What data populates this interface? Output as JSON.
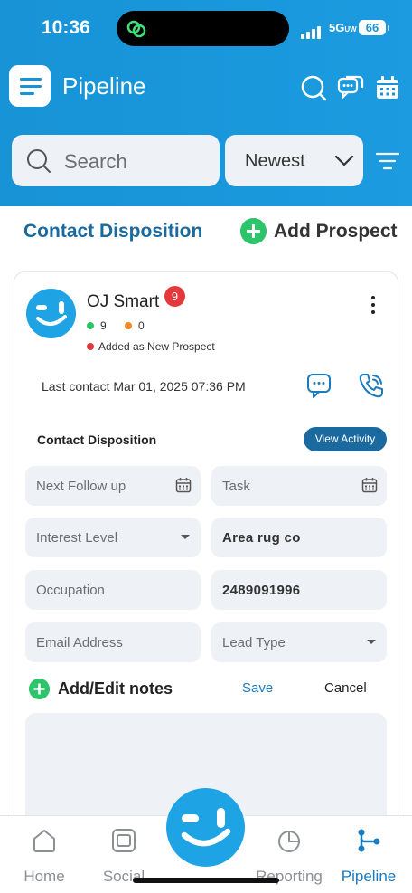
{
  "status_bar": {
    "time": "10:36",
    "network": "5G",
    "network_suffix": "UW",
    "battery": "66"
  },
  "header": {
    "title": "Pipeline",
    "icons": [
      "menu-icon",
      "search-icon",
      "chat-icon",
      "calendar-icon"
    ]
  },
  "search": {
    "placeholder": "Search"
  },
  "sort": {
    "selected": "Newest"
  },
  "links": {
    "contact_disposition": "Contact Disposition",
    "add_prospect": "Add Prospect"
  },
  "prospect": {
    "name": "OJ Smart",
    "badge_count": "9",
    "green_count": "9",
    "orange_count": "0",
    "status": "Added as New Prospect",
    "last_contact": "Last contact Mar 01, 2025 07:36 PM"
  },
  "disposition": {
    "title": "Contact Disposition",
    "view_activity": "View Activity",
    "fields": {
      "next_follow_up": "Next Follow up",
      "task": "Task",
      "interest_level": "Interest Level",
      "company": "Area rug co",
      "occupation": "Occupation",
      "phone": "2489091996",
      "email": "Email Address",
      "lead_type": "Lead Type"
    }
  },
  "notes": {
    "label": "Add/Edit notes",
    "save": "Save",
    "cancel": "Cancel"
  },
  "bottom_nav": {
    "items": [
      {
        "label": "Home",
        "icon": "home-icon"
      },
      {
        "label": "Social",
        "icon": "social-icon"
      },
      {
        "label": "Reporting",
        "icon": "reporting-icon"
      },
      {
        "label": "Pipeline",
        "icon": "pipeline-icon",
        "active": true
      }
    ]
  },
  "colors": {
    "brand_blue": "#1793d6",
    "accent_green": "#2ec46b",
    "badge_red": "#e5383b",
    "link_blue": "#1a6aa0"
  }
}
